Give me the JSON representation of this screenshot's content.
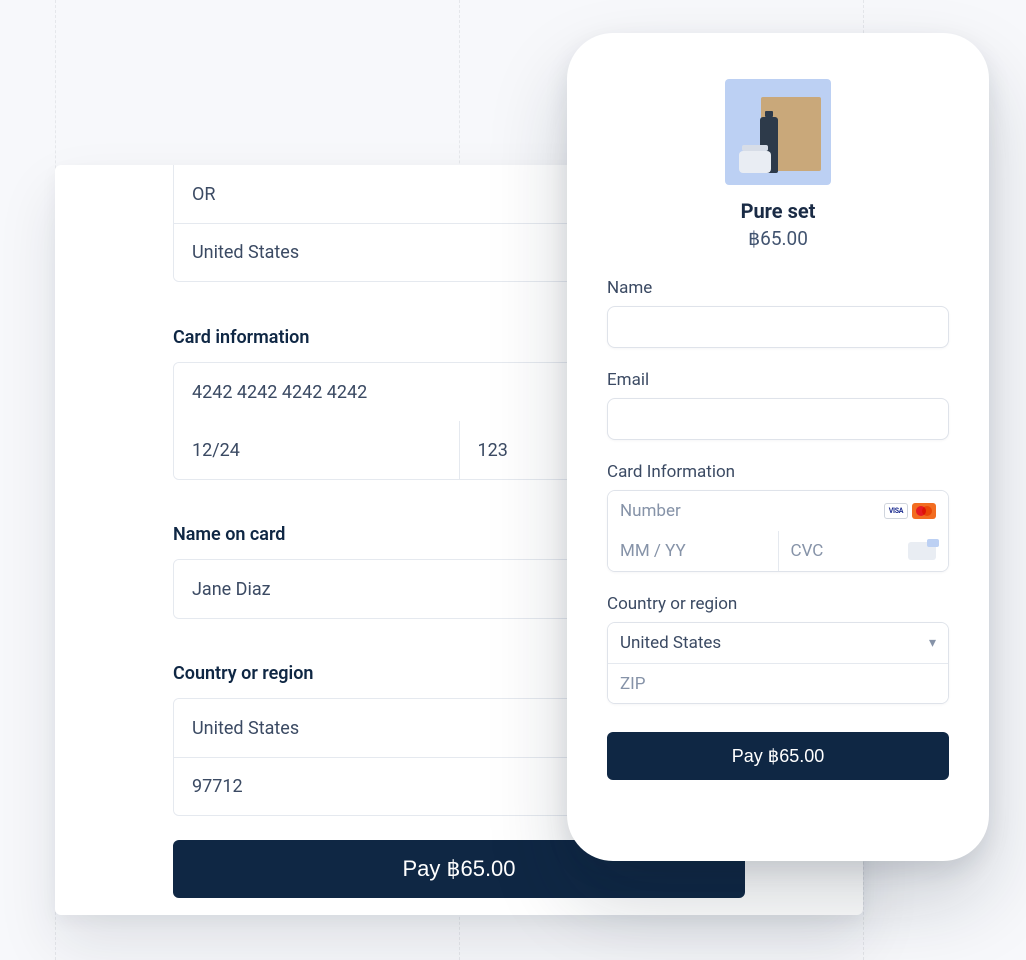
{
  "desktop": {
    "pre_region_state": "OR",
    "pre_region_country": "United States",
    "section_card": "Card information",
    "card_number": "4242 4242 4242 4242",
    "card_exp": "12/24",
    "card_cvc": "123",
    "section_name": "Name on card",
    "name_value": "Jane Diaz",
    "section_region": "Country or region",
    "region_country": "United States",
    "region_zip": "97712",
    "pay_label": "Pay ฿65.00"
  },
  "phone": {
    "product_name": "Pure set",
    "product_price": "฿65.00",
    "label_name": "Name",
    "label_email": "Email",
    "label_card": "Card Information",
    "placeholder_number": "Number",
    "placeholder_exp": "MM / YY",
    "placeholder_cvc": "CVC",
    "label_region": "Country or region",
    "region_country": "United States",
    "placeholder_zip": "ZIP",
    "pay_label": "Pay ฿65.00",
    "card_brands": [
      "visa",
      "mastercard"
    ]
  }
}
